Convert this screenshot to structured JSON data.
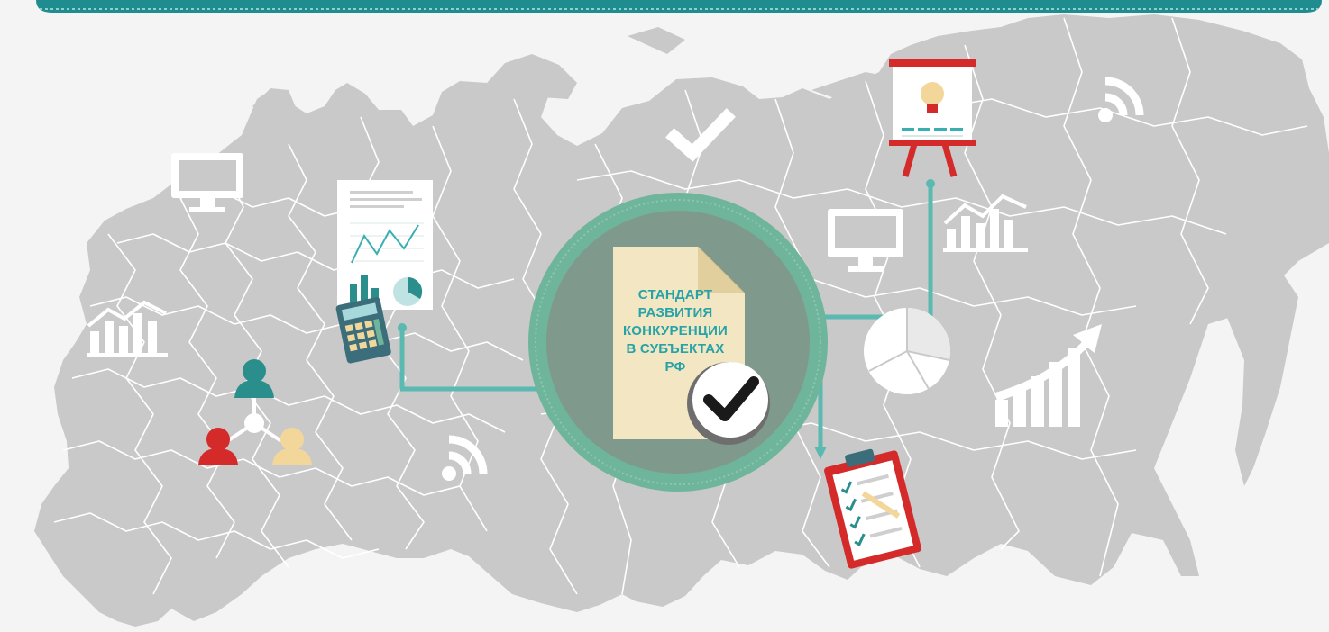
{
  "infographic": {
    "center_document": {
      "lines": [
        "СТАНДАРТ",
        "РАЗВИТИЯ",
        "КОНКУРЕНЦИИ",
        "В СУБЪЕКТАХ",
        "РФ"
      ]
    },
    "colors": {
      "banner": "#1f8c8f",
      "map": "#c9c9c9",
      "map_borders": "#ffffff",
      "background": "#f4f4f4",
      "circle_outer": "#6fb59c",
      "circle_inner": "#7f9a8c",
      "connector": "#5ab9b0",
      "accent_red": "#d42a2a",
      "accent_teal": "#2a8f8c",
      "accent_sand": "#f3d79a"
    },
    "icons": [
      "monitor-icon",
      "bar-chart-icon",
      "users-network-icon",
      "report-chart-icon",
      "calculator-icon",
      "checkmark-icon",
      "wifi-icon",
      "presentation-board-icon",
      "lightbulb-icon",
      "pie-chart-icon",
      "growth-chart-icon",
      "clipboard-checklist-icon",
      "approved-check-icon"
    ]
  }
}
